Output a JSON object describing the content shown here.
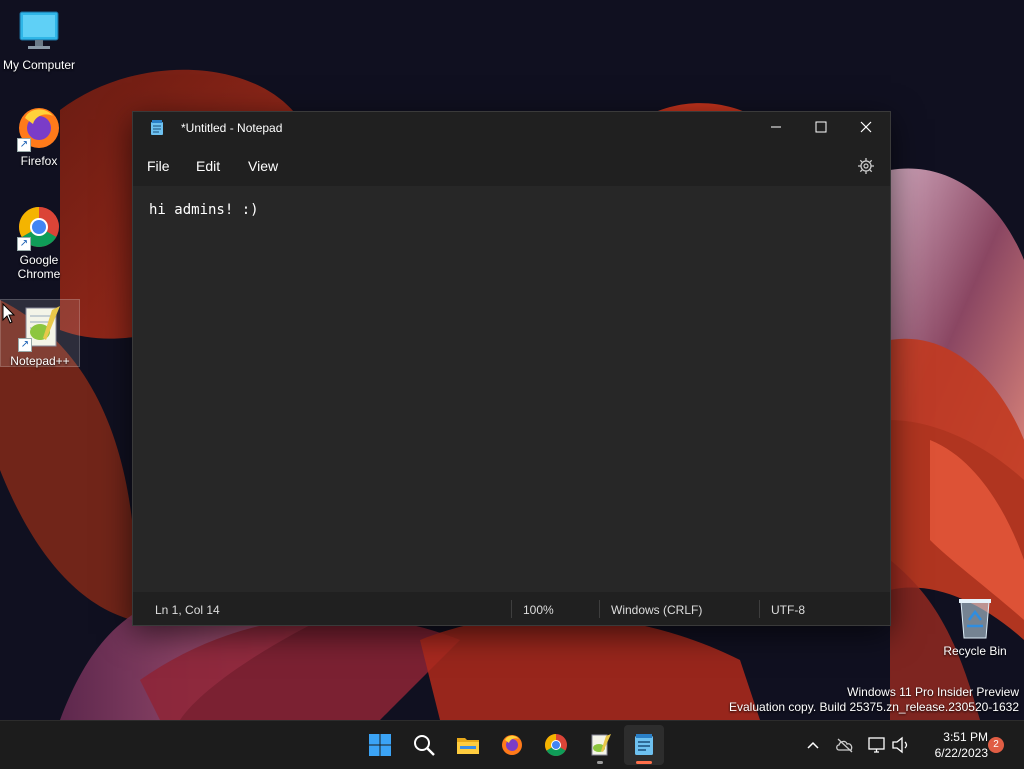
{
  "desktop": {
    "icons": [
      {
        "label": "My Computer"
      },
      {
        "label": "Firefox"
      },
      {
        "label": "Google Chrome"
      },
      {
        "label": "Notepad++"
      }
    ],
    "recycle_bin": {
      "label": "Recycle Bin"
    },
    "watermark": {
      "line1": "Windows 11 Pro Insider Preview",
      "line2": "Evaluation copy. Build 25375.zn_release.230520-1632"
    }
  },
  "notepad": {
    "title": "*Untitled - Notepad",
    "menu": [
      "File",
      "Edit",
      "View"
    ],
    "content": "hi admins! :)",
    "status": {
      "position": "Ln 1, Col 14",
      "zoom": "100%",
      "line_ending": "Windows (CRLF)",
      "encoding": "UTF-8"
    }
  },
  "taskbar": {
    "apps": [
      "start-icon",
      "search-icon",
      "file-explorer-icon",
      "firefox-icon",
      "chrome-icon",
      "notepad-plus-plus-icon",
      "notepad-icon"
    ],
    "clock": {
      "time": "3:51 PM",
      "date": "6/22/2023"
    },
    "notification_count": "2"
  },
  "colors": {
    "window_bg": "#202020",
    "editor_bg": "#272727",
    "taskbar_bg": "#1c1c1c",
    "accent": "#ff6f4a"
  }
}
